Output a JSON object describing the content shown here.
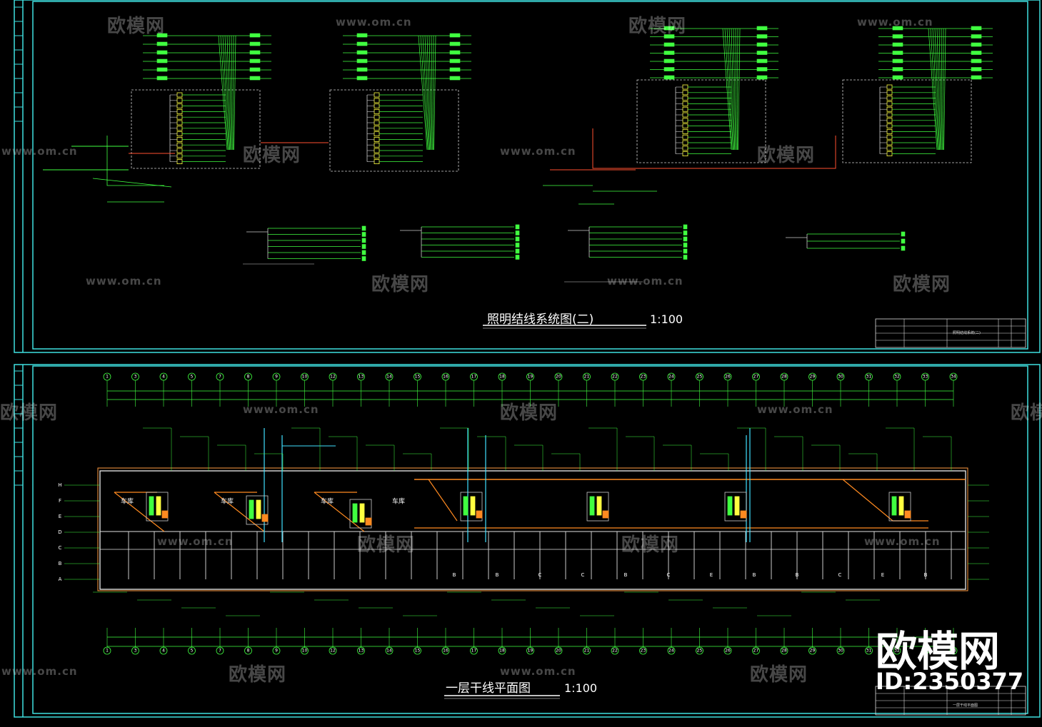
{
  "drawing_top": {
    "title": "照明结线系统图(二)",
    "scale": "1:100",
    "title_block": {
      "title": "照明结线系统(二)"
    }
  },
  "drawing_bottom": {
    "title": "一层干线平面图",
    "scale": "1:100",
    "title_block": {
      "title": "一层干线平面图"
    },
    "axis_labels_top": [
      "1",
      "3",
      "4",
      "5",
      "7",
      "8",
      "9",
      "10",
      "12",
      "13",
      "14",
      "15",
      "16",
      "17",
      "18",
      "19",
      "20",
      "21",
      "22",
      "23",
      "24",
      "25",
      "26",
      "27",
      "28",
      "29",
      "30",
      "31",
      "32",
      "33",
      "34"
    ],
    "row_labels": [
      "H",
      "F",
      "E",
      "D",
      "C",
      "B",
      "A"
    ],
    "room_labels": [
      "车库",
      "车库",
      "车库",
      "车库"
    ],
    "unit_labels": [
      "B",
      "B",
      "C",
      "C",
      "B",
      "C",
      "E",
      "B",
      "B",
      "C",
      "E",
      "B"
    ]
  },
  "watermark": {
    "brand": "欧模网",
    "url": "www.om.cn",
    "id_text": "ID:2350377"
  },
  "colors": {
    "frame": "#3fe0e0",
    "wire_green": "#40ff40",
    "wire_red": "#ff5030",
    "wire_orange": "#ff8a20",
    "wire_yellow": "#ffff40",
    "wire_cyan": "#40e0ff"
  }
}
